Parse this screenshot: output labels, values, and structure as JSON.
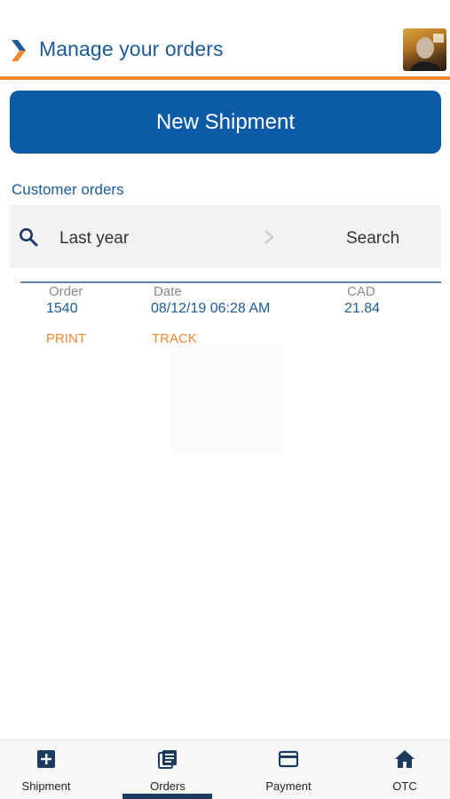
{
  "header": {
    "title": "Manage your orders",
    "back_icon": "chevron-right-icon",
    "accent_color": "#f28a2e"
  },
  "actions": {
    "new_shipment_label": "New Shipment"
  },
  "orders": {
    "section_title": "Customer orders",
    "filter": {
      "range_label": "Last year",
      "search_label": "Search"
    },
    "columns": [
      "Order",
      "Date",
      "CAD"
    ],
    "rows": [
      {
        "order": "1540",
        "date": "08/12/19 06:28 AM",
        "amount": "21.84",
        "print_label": "PRINT",
        "track_label": "TRACK"
      }
    ]
  },
  "tabbar": {
    "tabs": [
      {
        "label": "Shipment",
        "icon": "plus-square-icon"
      },
      {
        "label": "Orders",
        "icon": "orders-icon",
        "active": true
      },
      {
        "label": "Payment",
        "icon": "credit-card-icon"
      },
      {
        "label": "OTC",
        "icon": "home-icon"
      }
    ]
  },
  "colors": {
    "primary": "#0c5ba6",
    "accent": "#f28a2e",
    "text_blue": "#1a5c98"
  }
}
